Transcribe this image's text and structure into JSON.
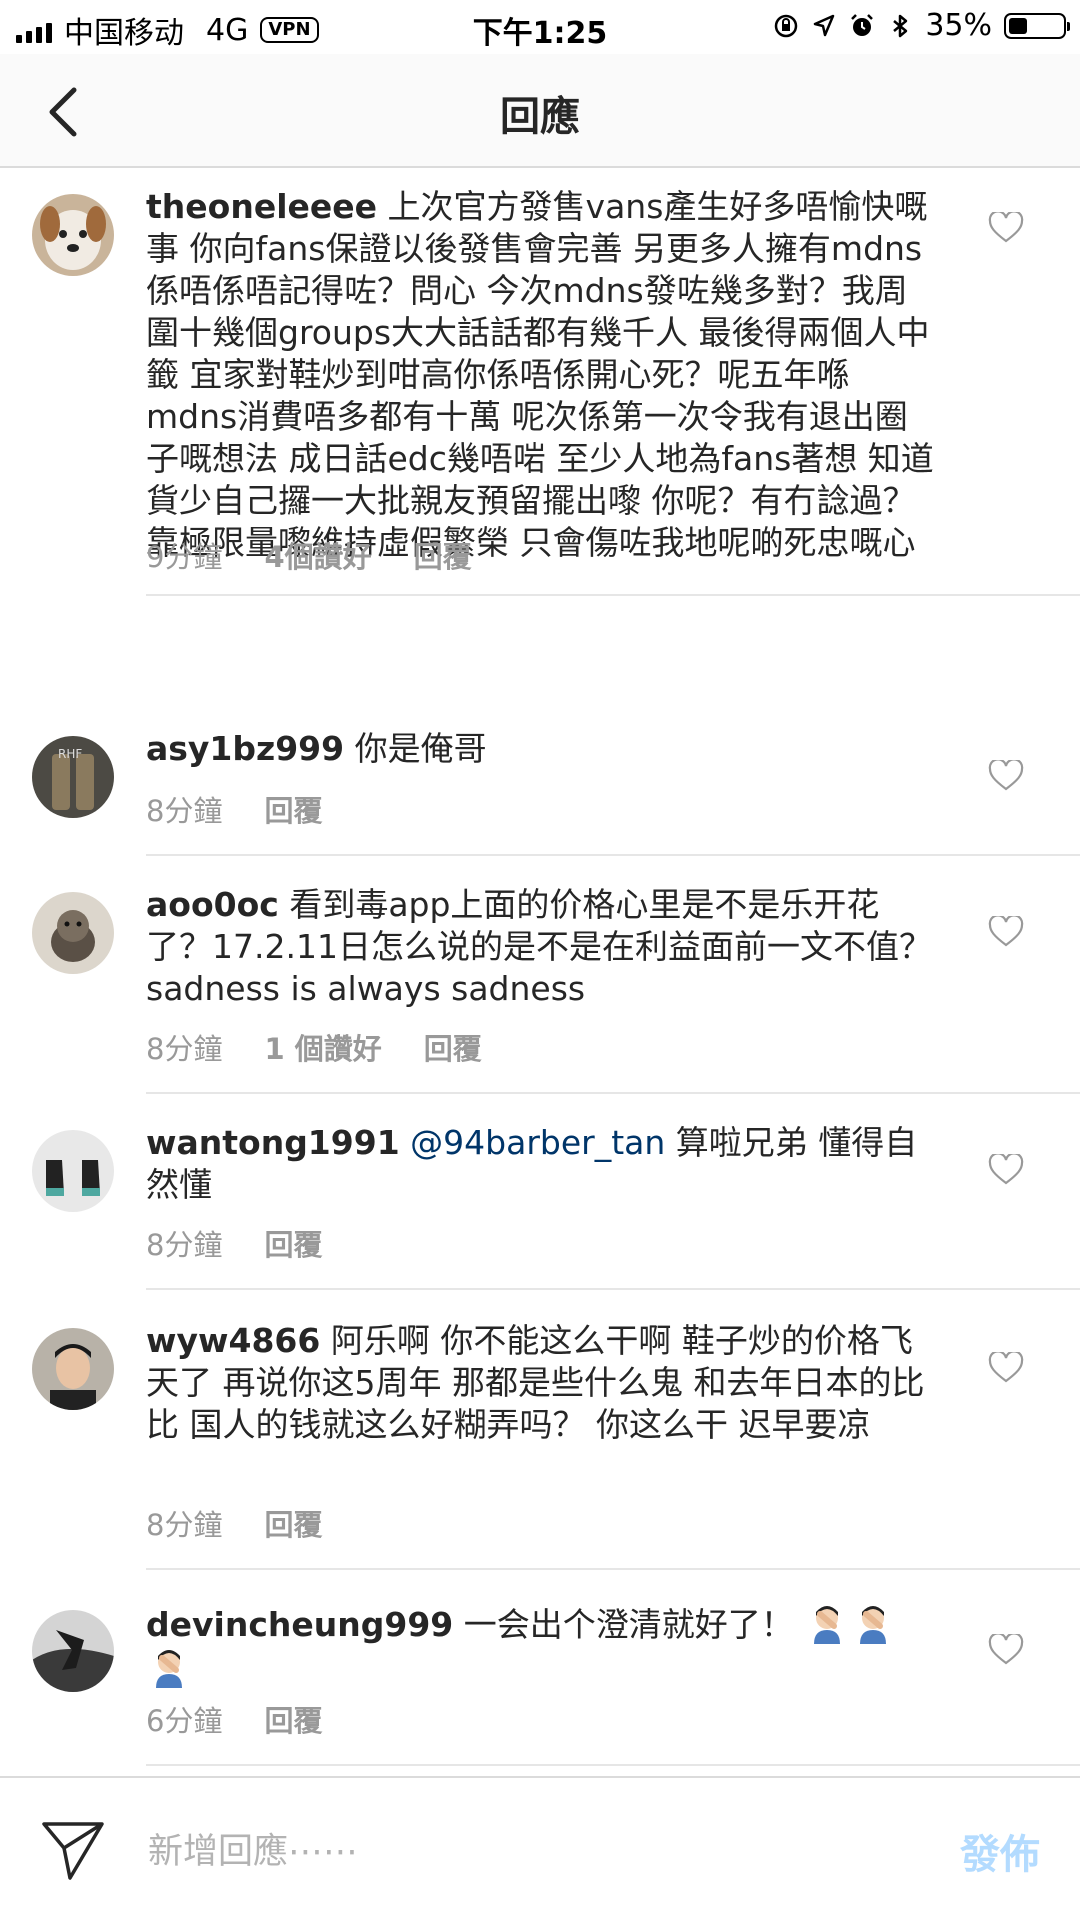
{
  "status_bar": {
    "carrier": "中国移动",
    "network": "4G",
    "vpn": "VPN",
    "time": "下午1:25",
    "battery": "35%",
    "battery_level": 0.35
  },
  "header": {
    "title": "回應"
  },
  "comments": [
    {
      "username": "theoneleeee",
      "text": "上次官方發售vans產生好多唔愉快嘅事 你向fans保證以後發售會完善 另更多人擁有mdns 係唔係唔記得咗？問心 今次mdns發咗幾多對？我周圍十幾個groups大大話話都有幾千人 最後得兩個人中籤 宜家對鞋炒到咁高你係唔係開心死？呢五年喺mdns消費唔多都有十萬 呢次係第一次令我有退出圈子嘅想法 成日話edc幾唔啱 至少人地為fans著想 知道貨少自己攞一大批親友預留擺出嚟 你呢？有冇諗過？靠極限量嚟維持虛假繁榮 只會傷咗我地呢啲死忠嘅心",
      "time": "9分鐘",
      "likes": "4個讚好",
      "reply": "回覆"
    },
    {
      "username": "asy1bz999",
      "text": "你是俺哥",
      "time": "8分鐘",
      "reply": "回覆"
    },
    {
      "username": "aoo0oc",
      "text": "看到毒app上面的价格心里是不是乐开花了？17.2.11日怎么说的是不是在利益面前一文不值？sadness is always sadness",
      "time": "8分鐘",
      "likes": "1 個讚好",
      "reply": "回覆"
    },
    {
      "username": "wantong1991",
      "mention": "@94barber_tan",
      "text": "算啦兄弟  懂得自然懂",
      "time": "8分鐘",
      "reply": "回覆"
    },
    {
      "username": "wyw4866",
      "text": "阿乐啊 你不能这么干啊  鞋子炒的价格飞天了  再说你这5周年 那都是些什么鬼  和去年日本的比比  国人的钱就这么好糊弄吗？ 你这么干 迟早要凉",
      "time": "8分鐘",
      "reply": "回覆"
    },
    {
      "username": "devincheung999",
      "text": "一会出个澄清就好了！",
      "emoji": "facepalm-emoji",
      "time": "6分鐘",
      "reply": "回覆"
    }
  ],
  "input_bar": {
    "placeholder": "新增回應⋯⋯",
    "post_label": "發佈",
    "post_color": "#b3dbff"
  },
  "colors": {
    "mention": "#003569",
    "meta": "#999999",
    "divider": "#e6e6e6"
  }
}
